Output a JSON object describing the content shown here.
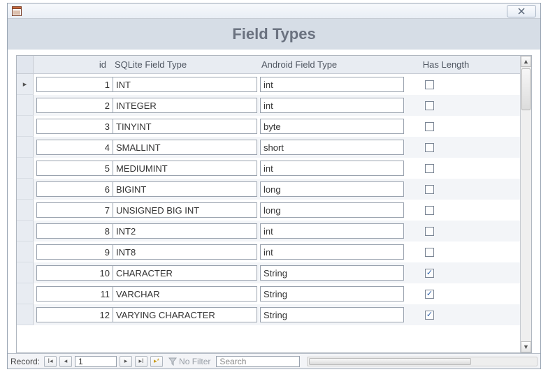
{
  "window": {
    "title": "Field Types"
  },
  "columns": {
    "id": "id",
    "sqlite": "SQLite Field Type",
    "android": "Android Field Type",
    "hasLength": "Has Length"
  },
  "rows": [
    {
      "id": "1",
      "sqlite": "INT",
      "android": "int",
      "hasLength": false
    },
    {
      "id": "2",
      "sqlite": "INTEGER",
      "android": "int",
      "hasLength": false
    },
    {
      "id": "3",
      "sqlite": "TINYINT",
      "android": "byte",
      "hasLength": false
    },
    {
      "id": "4",
      "sqlite": "SMALLINT",
      "android": "short",
      "hasLength": false
    },
    {
      "id": "5",
      "sqlite": "MEDIUMINT",
      "android": "int",
      "hasLength": false
    },
    {
      "id": "6",
      "sqlite": "BIGINT",
      "android": "long",
      "hasLength": false
    },
    {
      "id": "7",
      "sqlite": "UNSIGNED BIG INT",
      "android": "long",
      "hasLength": false
    },
    {
      "id": "8",
      "sqlite": "INT2",
      "android": "int",
      "hasLength": false
    },
    {
      "id": "9",
      "sqlite": "INT8",
      "android": "int",
      "hasLength": false
    },
    {
      "id": "10",
      "sqlite": "CHARACTER",
      "android": "String",
      "hasLength": true
    },
    {
      "id": "11",
      "sqlite": "VARCHAR",
      "android": "String",
      "hasLength": true
    },
    {
      "id": "12",
      "sqlite": "VARYING CHARACTER",
      "android": "String",
      "hasLength": true
    }
  ],
  "nav": {
    "recordLabel": "Record:",
    "current": "1",
    "noFilter": "No Filter",
    "searchPlaceholder": "Search"
  }
}
